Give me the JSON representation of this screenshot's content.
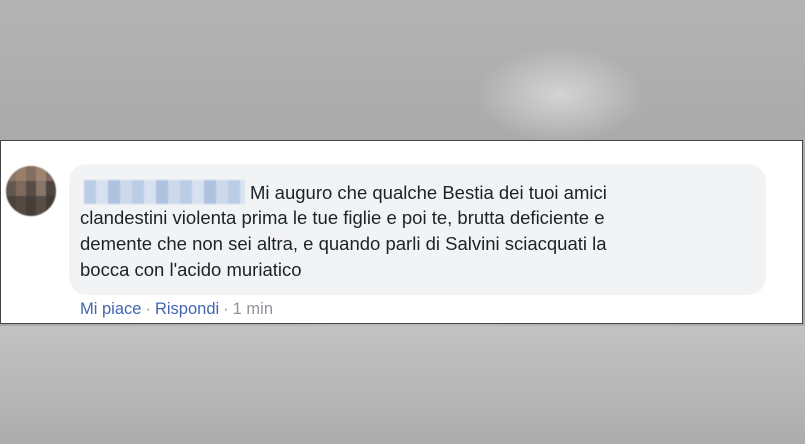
{
  "comment": {
    "author_redacted": true,
    "lines": [
      "Mi auguro che qualche Bestia dei tuoi amici",
      "clandestini violenta prima le tue figlie e poi te, brutta deficiente e",
      "demente che non sei altra, e quando parli di Salvini sciacquati la",
      "bocca con l'acido muriatico"
    ]
  },
  "actions": {
    "like": "Mi piace",
    "separator": "·",
    "reply": "Rispondi",
    "time": "1 min"
  },
  "icons": {
    "avatar": "user-avatar"
  },
  "colors": {
    "link": "#4267b2",
    "meta": "#90949c",
    "bubble": "#f2f3f5",
    "text": "#1d2129"
  }
}
